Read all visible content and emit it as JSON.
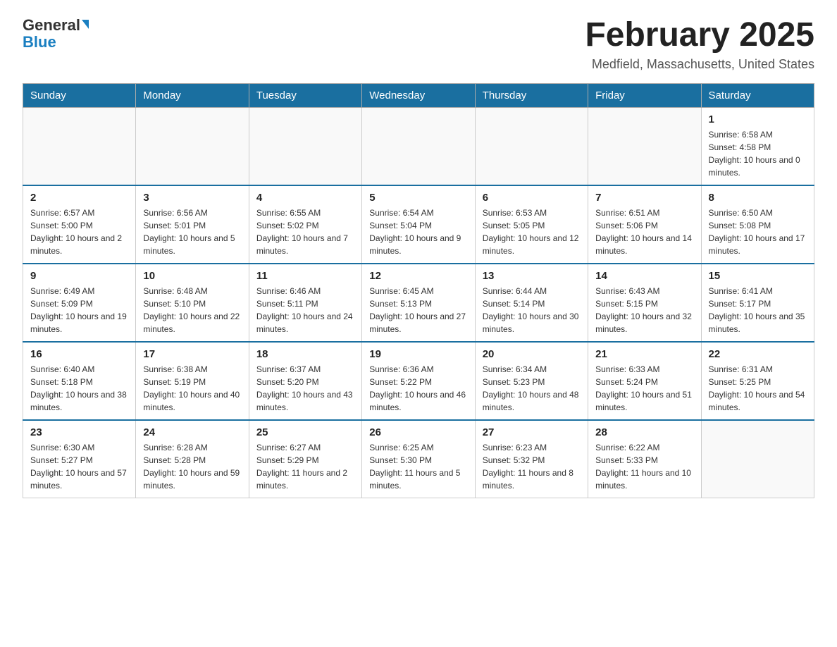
{
  "header": {
    "logo_general": "General",
    "logo_blue": "Blue",
    "month_title": "February 2025",
    "location": "Medfield, Massachusetts, United States"
  },
  "days_of_week": [
    "Sunday",
    "Monday",
    "Tuesday",
    "Wednesday",
    "Thursday",
    "Friday",
    "Saturday"
  ],
  "weeks": [
    [
      {
        "day": "",
        "info": ""
      },
      {
        "day": "",
        "info": ""
      },
      {
        "day": "",
        "info": ""
      },
      {
        "day": "",
        "info": ""
      },
      {
        "day": "",
        "info": ""
      },
      {
        "day": "",
        "info": ""
      },
      {
        "day": "1",
        "info": "Sunrise: 6:58 AM\nSunset: 4:58 PM\nDaylight: 10 hours and 0 minutes."
      }
    ],
    [
      {
        "day": "2",
        "info": "Sunrise: 6:57 AM\nSunset: 5:00 PM\nDaylight: 10 hours and 2 minutes."
      },
      {
        "day": "3",
        "info": "Sunrise: 6:56 AM\nSunset: 5:01 PM\nDaylight: 10 hours and 5 minutes."
      },
      {
        "day": "4",
        "info": "Sunrise: 6:55 AM\nSunset: 5:02 PM\nDaylight: 10 hours and 7 minutes."
      },
      {
        "day": "5",
        "info": "Sunrise: 6:54 AM\nSunset: 5:04 PM\nDaylight: 10 hours and 9 minutes."
      },
      {
        "day": "6",
        "info": "Sunrise: 6:53 AM\nSunset: 5:05 PM\nDaylight: 10 hours and 12 minutes."
      },
      {
        "day": "7",
        "info": "Sunrise: 6:51 AM\nSunset: 5:06 PM\nDaylight: 10 hours and 14 minutes."
      },
      {
        "day": "8",
        "info": "Sunrise: 6:50 AM\nSunset: 5:08 PM\nDaylight: 10 hours and 17 minutes."
      }
    ],
    [
      {
        "day": "9",
        "info": "Sunrise: 6:49 AM\nSunset: 5:09 PM\nDaylight: 10 hours and 19 minutes."
      },
      {
        "day": "10",
        "info": "Sunrise: 6:48 AM\nSunset: 5:10 PM\nDaylight: 10 hours and 22 minutes."
      },
      {
        "day": "11",
        "info": "Sunrise: 6:46 AM\nSunset: 5:11 PM\nDaylight: 10 hours and 24 minutes."
      },
      {
        "day": "12",
        "info": "Sunrise: 6:45 AM\nSunset: 5:13 PM\nDaylight: 10 hours and 27 minutes."
      },
      {
        "day": "13",
        "info": "Sunrise: 6:44 AM\nSunset: 5:14 PM\nDaylight: 10 hours and 30 minutes."
      },
      {
        "day": "14",
        "info": "Sunrise: 6:43 AM\nSunset: 5:15 PM\nDaylight: 10 hours and 32 minutes."
      },
      {
        "day": "15",
        "info": "Sunrise: 6:41 AM\nSunset: 5:17 PM\nDaylight: 10 hours and 35 minutes."
      }
    ],
    [
      {
        "day": "16",
        "info": "Sunrise: 6:40 AM\nSunset: 5:18 PM\nDaylight: 10 hours and 38 minutes."
      },
      {
        "day": "17",
        "info": "Sunrise: 6:38 AM\nSunset: 5:19 PM\nDaylight: 10 hours and 40 minutes."
      },
      {
        "day": "18",
        "info": "Sunrise: 6:37 AM\nSunset: 5:20 PM\nDaylight: 10 hours and 43 minutes."
      },
      {
        "day": "19",
        "info": "Sunrise: 6:36 AM\nSunset: 5:22 PM\nDaylight: 10 hours and 46 minutes."
      },
      {
        "day": "20",
        "info": "Sunrise: 6:34 AM\nSunset: 5:23 PM\nDaylight: 10 hours and 48 minutes."
      },
      {
        "day": "21",
        "info": "Sunrise: 6:33 AM\nSunset: 5:24 PM\nDaylight: 10 hours and 51 minutes."
      },
      {
        "day": "22",
        "info": "Sunrise: 6:31 AM\nSunset: 5:25 PM\nDaylight: 10 hours and 54 minutes."
      }
    ],
    [
      {
        "day": "23",
        "info": "Sunrise: 6:30 AM\nSunset: 5:27 PM\nDaylight: 10 hours and 57 minutes."
      },
      {
        "day": "24",
        "info": "Sunrise: 6:28 AM\nSunset: 5:28 PM\nDaylight: 10 hours and 59 minutes."
      },
      {
        "day": "25",
        "info": "Sunrise: 6:27 AM\nSunset: 5:29 PM\nDaylight: 11 hours and 2 minutes."
      },
      {
        "day": "26",
        "info": "Sunrise: 6:25 AM\nSunset: 5:30 PM\nDaylight: 11 hours and 5 minutes."
      },
      {
        "day": "27",
        "info": "Sunrise: 6:23 AM\nSunset: 5:32 PM\nDaylight: 11 hours and 8 minutes."
      },
      {
        "day": "28",
        "info": "Sunrise: 6:22 AM\nSunset: 5:33 PM\nDaylight: 11 hours and 10 minutes."
      },
      {
        "day": "",
        "info": ""
      }
    ]
  ]
}
